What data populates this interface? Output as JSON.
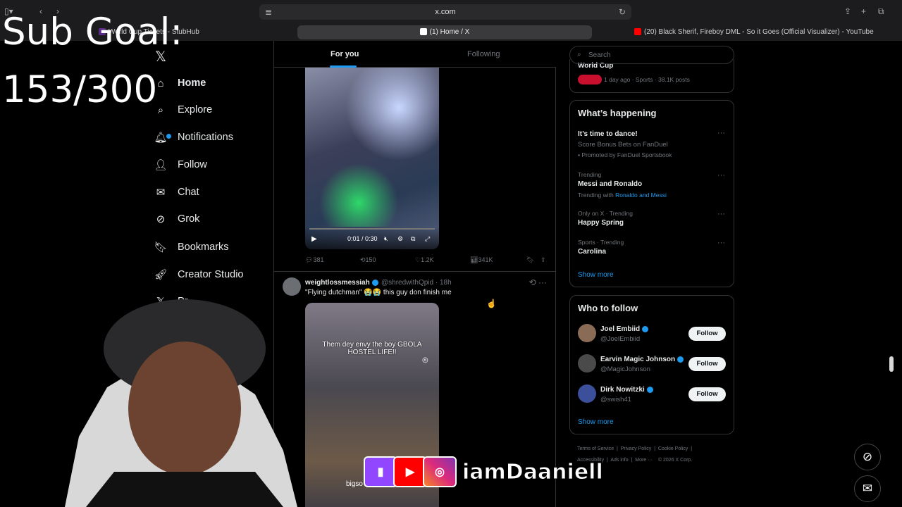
{
  "browser": {
    "url": "x.com",
    "tabs": [
      {
        "label": "World Cup Tickets - StubHub"
      },
      {
        "label": "(1) Home / X"
      },
      {
        "label": "(20) Black Sherif, Fireboy DML - So it Goes (Official Visualizer) - YouTube"
      }
    ]
  },
  "overlay": {
    "sub_goal_label": "Sub Goal:",
    "sub_goal_value": "153/300",
    "social_handle": "iamDaaniell"
  },
  "nav": {
    "items": [
      {
        "label": "Home",
        "icon": "home-icon"
      },
      {
        "label": "Explore",
        "icon": "search-icon"
      },
      {
        "label": "Notifications",
        "icon": "bell-icon"
      },
      {
        "label": "Follow",
        "icon": "person-plus-icon"
      },
      {
        "label": "Chat",
        "icon": "mail-icon"
      },
      {
        "label": "Grok",
        "icon": "grok-icon"
      },
      {
        "label": "Bookmarks",
        "icon": "bookmark-icon"
      },
      {
        "label": "Creator Studio",
        "icon": "rocket-icon"
      },
      {
        "label": "Pr",
        "icon": "x-logo-icon"
      }
    ]
  },
  "feed": {
    "tabs": {
      "for_you": "For you",
      "following": "Following"
    },
    "video1": {
      "time": "0:01 / 0:30",
      "replies": "381",
      "reposts": "150",
      "likes": "1.2K",
      "views": "341K"
    },
    "tweet2": {
      "username": "weightlossmessiah",
      "handle": "@shredwithQpid · 18h",
      "text": "\"Flying dutchman\" 😭😭 this guy don finish me",
      "overlay_text": "Them dey envy the boy GBOLA HOSTEL LIFE!!",
      "overlay_bottom": "bigso"
    }
  },
  "sidebar": {
    "search_placeholder": "Search",
    "top_trend": {
      "title": "World Cup",
      "meta": "1 day ago · Sports · 38.1K posts"
    },
    "whats_happening": {
      "title": "What’s happening",
      "items": [
        {
          "meta": "",
          "title": "It’s time to dance!",
          "sub": "Score Bonus Bets on FanDuel",
          "promo": "Promoted by FanDuel Sportsbook"
        },
        {
          "meta": "Trending",
          "title": "Messi and Ronaldo",
          "sub": "Trending with",
          "link": "Ronaldo and Messi"
        },
        {
          "meta": "Only on X · Trending",
          "title": "Happy Spring"
        },
        {
          "meta": "Sports · Trending",
          "title": "Carolina"
        }
      ],
      "show_more": "Show more"
    },
    "who_to_follow": {
      "title": "Who to follow",
      "users": [
        {
          "name": "Joel Embiid",
          "handle": "@JoelEmbiid",
          "button": "Follow"
        },
        {
          "name": "Earvin Magic Johnson",
          "handle": "@MagicJohnson",
          "button": "Follow"
        },
        {
          "name": "Dirk Nowitzki",
          "handle": "@swish41",
          "button": "Follow"
        }
      ],
      "show_more": "Show more"
    },
    "footer": {
      "links": [
        "Terms of Service",
        "Privacy Policy",
        "Cookie Policy",
        "Accessibility",
        "Ads info",
        "More ···",
        "© 2026 X Corp."
      ]
    }
  },
  "colors": {
    "accent": "#1d9bf0",
    "background": "#000000",
    "text": "#e7e9ea",
    "muted": "#71767b"
  }
}
